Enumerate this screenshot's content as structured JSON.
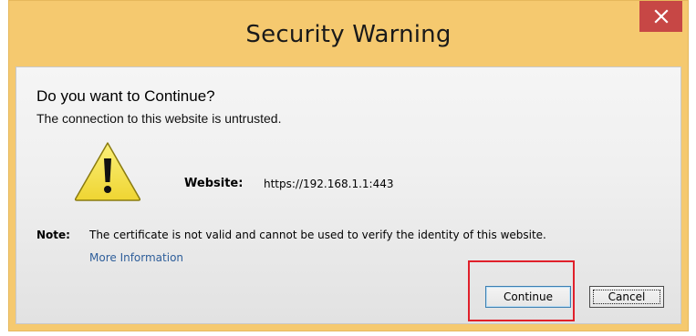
{
  "window": {
    "title": "Security Warning",
    "close_symbol": "✕"
  },
  "dialog": {
    "heading": "Do you want to Continue?",
    "subheading": "The connection to this website is untrusted.",
    "icon": "warning-triangle-icon",
    "website_label": "Website:",
    "website_value": "https://192.168.1.1:443",
    "note_label": "Note:",
    "note_text": "The certificate is not valid and cannot be used to verify the identity of this website.",
    "more_info_link": "More Information"
  },
  "buttons": {
    "continue_label": "Continue",
    "cancel_label": "Cancel"
  },
  "colors": {
    "titlebar": "#f5c96f",
    "close_button": "#c74745",
    "highlight": "#e0202a",
    "link": "#2e5e9a",
    "warning_icon": "#f6e24a"
  }
}
